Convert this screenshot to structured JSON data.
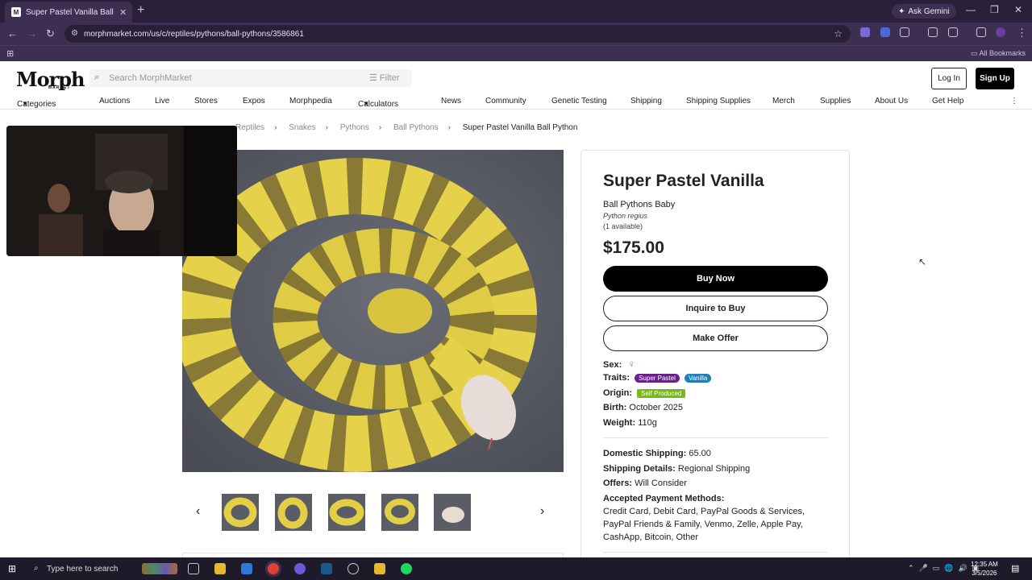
{
  "browser": {
    "tab_title": "Super Pastel Vanilla Ball Python",
    "tab_favicon": "M",
    "gemini_label": "Ask Gemini",
    "url": "morphmarket.com/us/c/reptiles/pythons/ball-pythons/3586861",
    "all_bookmarks": "All Bookmarks"
  },
  "site": {
    "logo": "Morph",
    "logo_sub": "MARKET",
    "search_placeholder": "Search MorphMarket",
    "filter_label": "Filter",
    "login_label": "Log In",
    "signup_label": "Sign Up"
  },
  "menu": [
    "Categories",
    "Auctions",
    "Live",
    "Stores",
    "Expos",
    "Morphpedia",
    "Calculators",
    "News",
    "Community",
    "Genetic Testing",
    "Shipping",
    "Shipping Supplies",
    "Merch",
    "Supplies",
    "About Us",
    "Get Help"
  ],
  "breadcrumb": {
    "items": [
      "Reptiles",
      "Snakes",
      "Pythons",
      "Ball Pythons"
    ],
    "current": "Super Pastel Vanilla Ball Python"
  },
  "listing": {
    "title": "Super Pastel Vanilla",
    "subtitle": "Ball Pythons Baby",
    "scientific": "Python regius",
    "availability": "(1 available)",
    "price": "$175.00",
    "buy_label": "Buy Now",
    "inquire_label": "Inquire to Buy",
    "offer_label": "Make Offer",
    "sex_label": "Sex:",
    "sex_symbol": "♀",
    "traits_label": "Traits:",
    "traits": [
      {
        "name": "Super Pastel",
        "color": "#6a1f8a"
      },
      {
        "name": "Vanilla",
        "color": "#1f7fb8"
      }
    ],
    "origin_label": "Origin:",
    "origin_value": "Self Produced",
    "origin_color": "#78b81a",
    "birth_label": "Birth:",
    "birth_value": "October 2025",
    "weight_label": "Weight:",
    "weight_value": "110g",
    "domestic_shipping_label": "Domestic Shipping:",
    "domestic_shipping_value": "65.00",
    "shipping_details_label": "Shipping Details:",
    "shipping_details_value": "Regional Shipping",
    "offers_label": "Offers:",
    "offers_value": "Will Consider",
    "payment_label": "Accepted Payment Methods:",
    "payment_methods": "Credit Card, Debit Card, PayPal Goods & Services, PayPal Friends & Family, Venmo, Zelle, Apple Pay, CashApp, Bitcoin, Other"
  },
  "taskbar": {
    "search_placeholder": "Type here to search",
    "time": "12:35 AM",
    "date": "3/5/2026"
  },
  "colors": {
    "browser_dark": "#2a1f38",
    "browser_mid": "#3d2f52",
    "accent_black": "#000000",
    "female_pink": "#e0567a"
  }
}
